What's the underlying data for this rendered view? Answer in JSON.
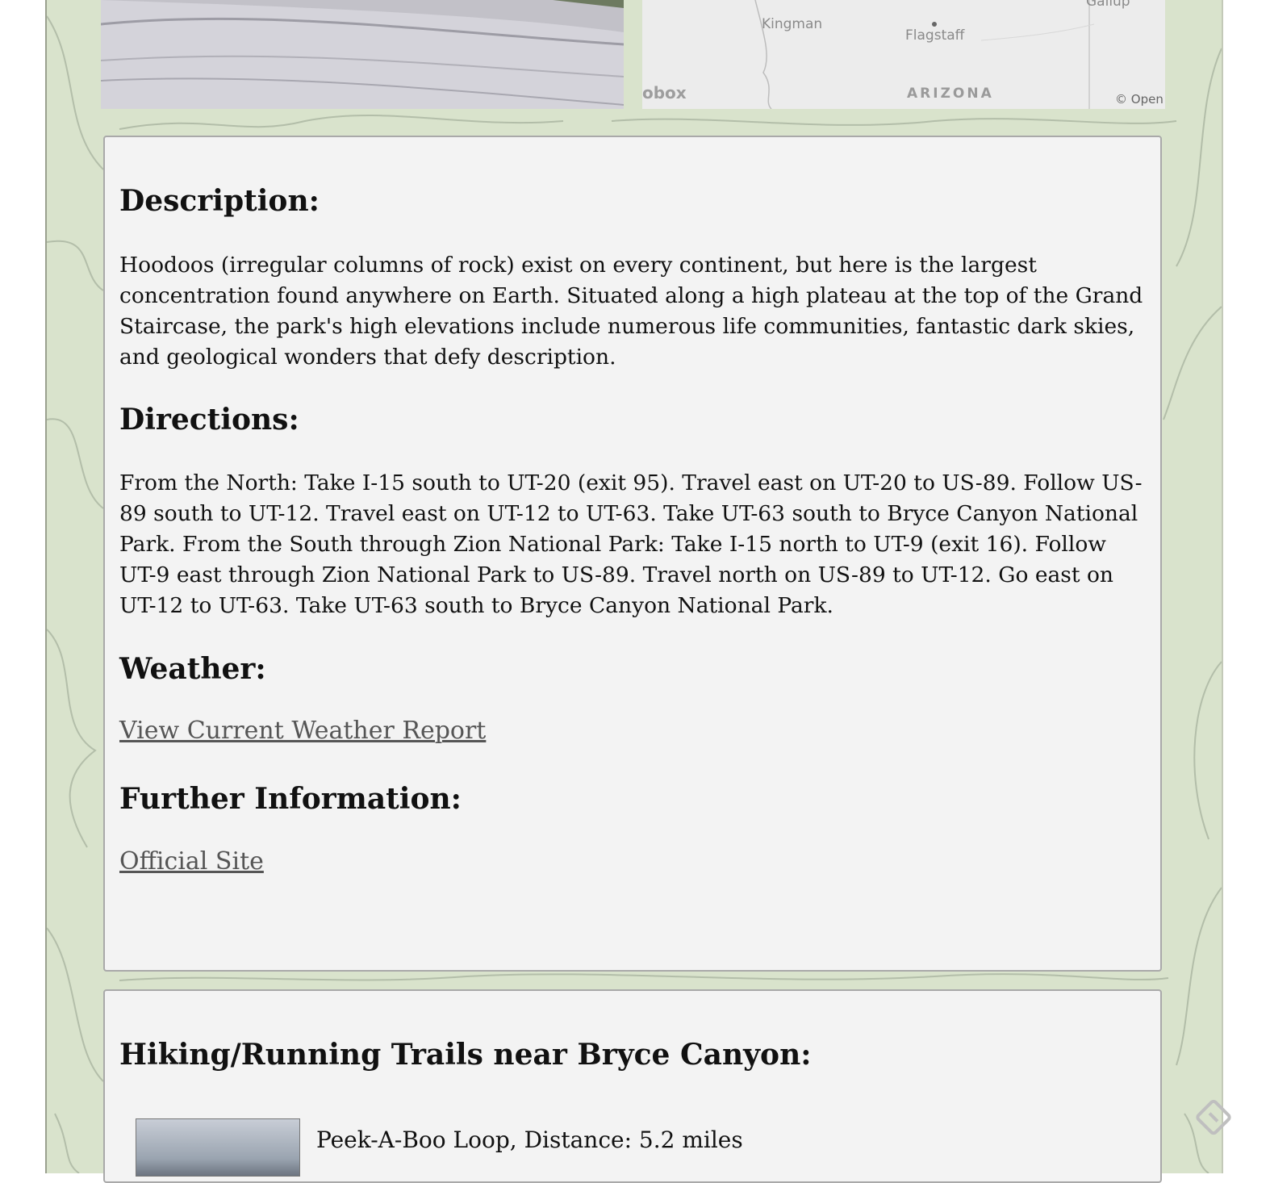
{
  "map": {
    "labels": {
      "kingman": "Kingman",
      "flagstaff": "Flagstaff",
      "gallup": "Gallup",
      "arizona": "ARIZONA",
      "attribution": "© Open",
      "logo": "obox"
    }
  },
  "details": {
    "description_heading": "Description:",
    "description_text": "Hoodoos (irregular columns of rock) exist on every continent, but here is the largest concentration found anywhere on Earth. Situated along a high plateau at the top of the Grand Staircase, the park's high elevations include numerous life communities, fantastic dark skies, and geological wonders that defy description.",
    "directions_heading": "Directions:",
    "directions_text": "From the North: Take I-15 south to UT-20 (exit 95). Travel east on UT-20 to US-89. Follow US-89 south to UT-12. Travel east on UT-12 to UT-63. Take UT-63 south to Bryce Canyon National Park. From the South through Zion National Park: Take I-15 north to UT-9 (exit 16). Follow UT-9 east through Zion National Park to US-89. Travel north on US-89 to UT-12. Go east on UT-12 to UT-63. Take UT-63 south to Bryce Canyon National Park.",
    "weather_heading": "Weather:",
    "weather_link": "View Current Weather Report",
    "further_heading": "Further Information:",
    "official_link": "Official Site"
  },
  "trails": {
    "heading": "Hiking/Running Trails near Bryce Canyon:",
    "items": [
      {
        "name": "Peek-A-Boo Loop, Distance: 5.2 miles"
      }
    ]
  },
  "colors": {
    "background": "#d9e3cc",
    "card": "#f3f3f3",
    "link": "#555555"
  }
}
